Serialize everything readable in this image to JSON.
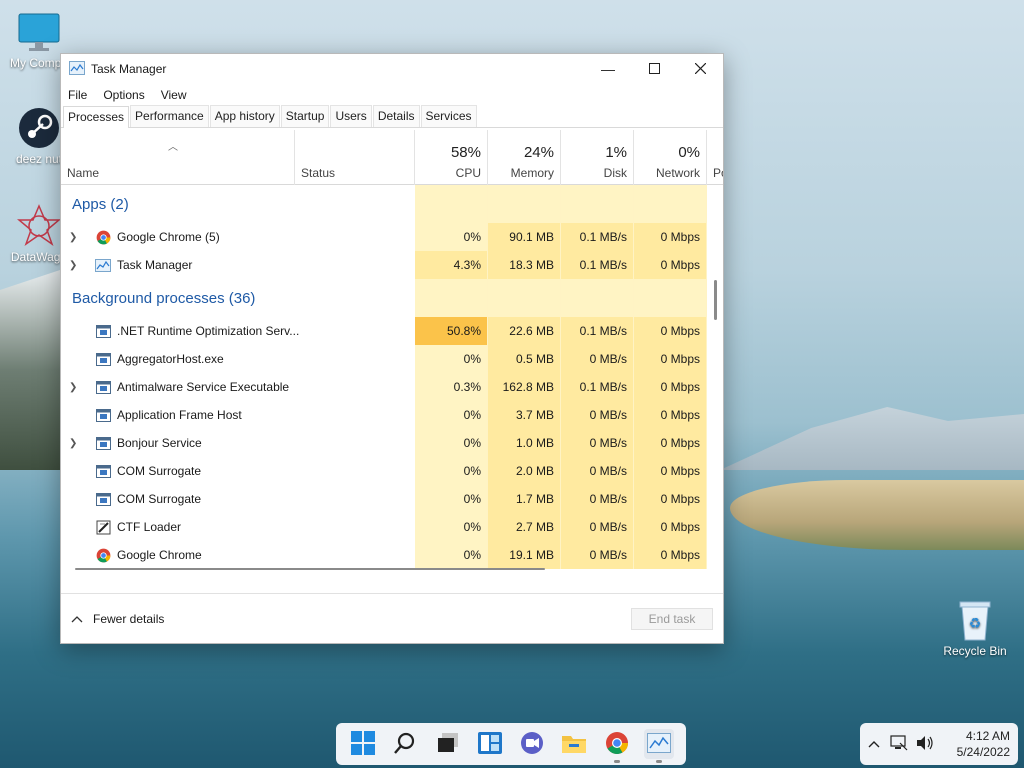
{
  "desktop": {
    "icons": [
      {
        "label": "My Compu",
        "icon": "monitor-icon"
      },
      {
        "label": "deez nut",
        "icon": "steam-icon"
      },
      {
        "label": "DataWago",
        "icon": "datawagon-icon"
      },
      {
        "label": "Recycle Bin",
        "icon": "recycle-bin-icon"
      }
    ]
  },
  "window": {
    "title": "Task Manager",
    "menu": [
      "File",
      "Options",
      "View"
    ],
    "tabs": [
      "Processes",
      "Performance",
      "App history",
      "Startup",
      "Users",
      "Details",
      "Services"
    ],
    "active_tab": "Processes"
  },
  "columns": {
    "name": "Name",
    "status": "Status",
    "cpu": {
      "pct": "58%",
      "label": "CPU"
    },
    "memory": {
      "pct": "24%",
      "label": "Memory"
    },
    "disk": {
      "pct": "1%",
      "label": "Disk"
    },
    "network": {
      "pct": "0%",
      "label": "Network"
    },
    "power": "Po"
  },
  "groups": {
    "apps": "Apps (2)",
    "background": "Background processes (36)"
  },
  "apps": [
    {
      "name": "Google Chrome (5)",
      "icon": "chrome-icon",
      "expandable": true,
      "cpu": "0%",
      "memory": "90.1 MB",
      "disk": "0.1 MB/s",
      "network": "0 Mbps"
    },
    {
      "name": "Task Manager",
      "icon": "taskmgr-icon",
      "expandable": true,
      "cpu": "4.3%",
      "memory": "18.3 MB",
      "disk": "0.1 MB/s",
      "network": "0 Mbps"
    }
  ],
  "background": [
    {
      "name": ".NET Runtime Optimization Serv...",
      "icon": "service-icon",
      "expandable": false,
      "cpu": "50.8%",
      "memory": "22.6 MB",
      "disk": "0.1 MB/s",
      "network": "0 Mbps"
    },
    {
      "name": "AggregatorHost.exe",
      "icon": "service-icon",
      "expandable": false,
      "cpu": "0%",
      "memory": "0.5 MB",
      "disk": "0 MB/s",
      "network": "0 Mbps"
    },
    {
      "name": "Antimalware Service Executable",
      "icon": "service-icon",
      "expandable": true,
      "cpu": "0.3%",
      "memory": "162.8 MB",
      "disk": "0.1 MB/s",
      "network": "0 Mbps"
    },
    {
      "name": "Application Frame Host",
      "icon": "service-icon",
      "expandable": false,
      "cpu": "0%",
      "memory": "3.7 MB",
      "disk": "0 MB/s",
      "network": "0 Mbps"
    },
    {
      "name": "Bonjour Service",
      "icon": "service-icon",
      "expandable": true,
      "cpu": "0%",
      "memory": "1.0 MB",
      "disk": "0 MB/s",
      "network": "0 Mbps"
    },
    {
      "name": "COM Surrogate",
      "icon": "service-icon",
      "expandable": false,
      "cpu": "0%",
      "memory": "2.0 MB",
      "disk": "0 MB/s",
      "network": "0 Mbps"
    },
    {
      "name": "COM Surrogate",
      "icon": "service-icon",
      "expandable": false,
      "cpu": "0%",
      "memory": "1.7 MB",
      "disk": "0 MB/s",
      "network": "0 Mbps"
    },
    {
      "name": "CTF Loader",
      "icon": "ctf-icon",
      "expandable": false,
      "cpu": "0%",
      "memory": "2.7 MB",
      "disk": "0 MB/s",
      "network": "0 Mbps"
    },
    {
      "name": "Google Chrome",
      "icon": "chrome-icon",
      "expandable": false,
      "cpu": "0%",
      "memory": "19.1 MB",
      "disk": "0 MB/s",
      "network": "0 Mbps"
    }
  ],
  "footer": {
    "fewer_details": "Fewer details",
    "end_task": "End task"
  },
  "tray": {
    "time": "4:12 AM",
    "date": "5/24/2022"
  },
  "colors": {
    "heat_light": "#fff4c4",
    "heat_mid": "#ffeaa0",
    "heat_high": "#fbc34a",
    "accent": "#1f5aa6"
  }
}
